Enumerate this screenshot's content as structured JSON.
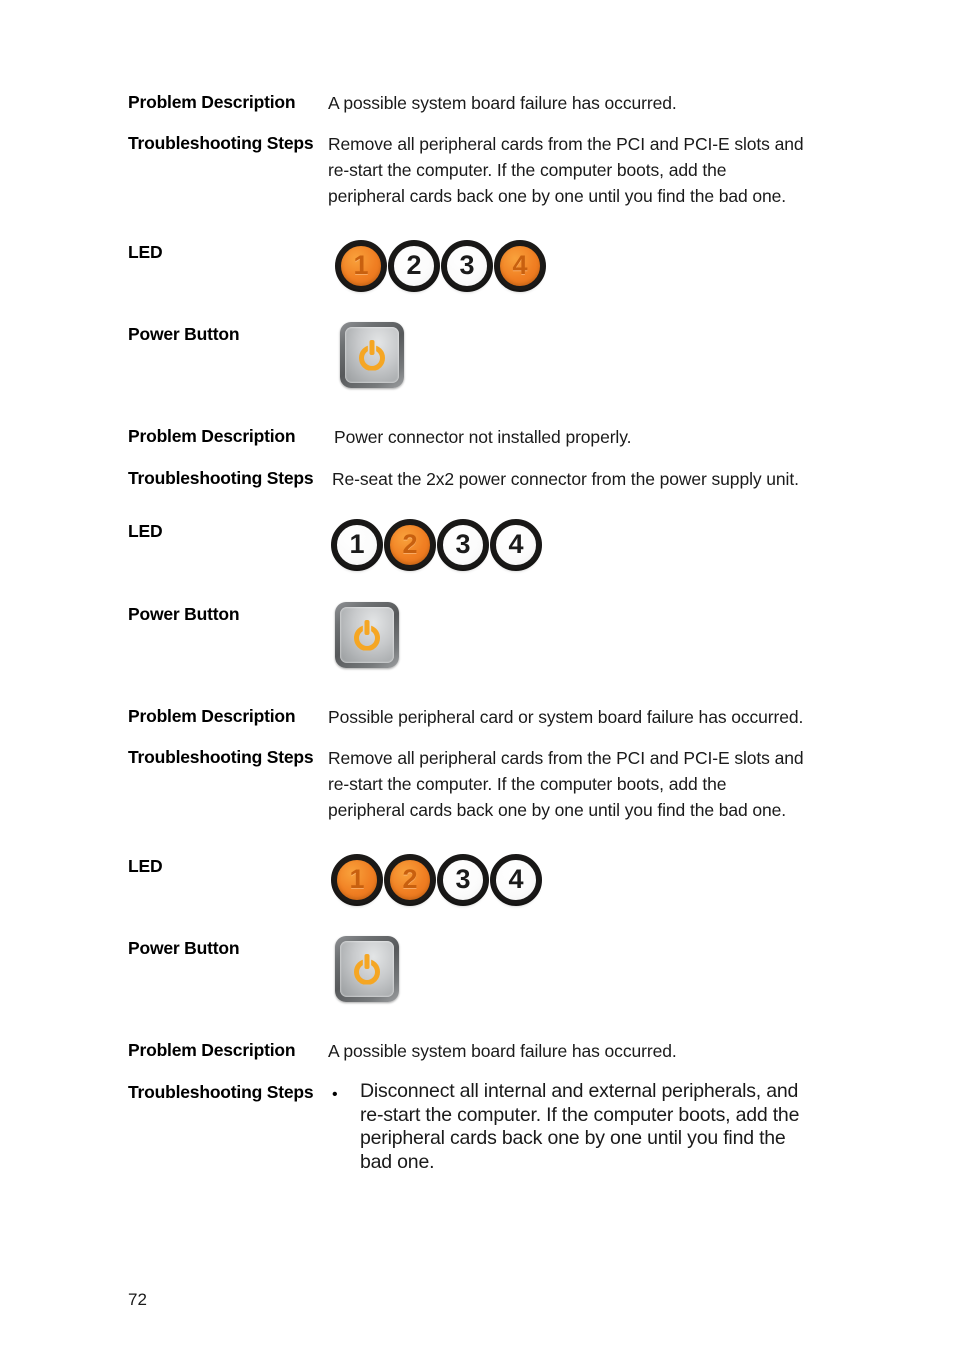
{
  "document": {
    "page_number": "72",
    "colors": {
      "led_on": "#f07e22",
      "led_off": "#ffffff",
      "power_glyph": "#f5a623",
      "text": "#1a1a1a"
    }
  },
  "labels": {
    "problem_description": "Problem Description",
    "troubleshooting_steps": "Troubleshooting Steps",
    "led": "LED",
    "power_button": "Power Button"
  },
  "sections": [
    {
      "problem_description": "A possible system board failure has occurred.",
      "troubleshooting_lines": [
        "Remove all peripheral cards from the PCI and PCI-E slots and",
        "re-start the computer. If the computer boots, add the",
        "peripheral cards back one by one until you find the bad one."
      ],
      "led_states": [
        {
          "number": "1",
          "lit": true
        },
        {
          "number": "2",
          "lit": false
        },
        {
          "number": "3",
          "lit": false
        },
        {
          "number": "4",
          "lit": true
        }
      ],
      "power_button_state": "on"
    },
    {
      "problem_description": "Power connector not installed properly.",
      "troubleshooting_lines": [
        "Re-seat the 2x2 power connector from the power supply unit."
      ],
      "led_states": [
        {
          "number": "1",
          "lit": false
        },
        {
          "number": "2",
          "lit": true
        },
        {
          "number": "3",
          "lit": false
        },
        {
          "number": "4",
          "lit": false
        }
      ],
      "power_button_state": "on"
    },
    {
      "problem_description": "Possible peripheral card or system board failure has occurred.",
      "troubleshooting_lines": [
        "Remove all peripheral cards from the PCI and PCI-E slots and",
        "re-start the computer. If the computer boots, add the",
        "peripheral cards back one by one until you find the bad one."
      ],
      "led_states": [
        {
          "number": "1",
          "lit": true
        },
        {
          "number": "2",
          "lit": true
        },
        {
          "number": "3",
          "lit": false
        },
        {
          "number": "4",
          "lit": false
        }
      ],
      "power_button_state": "on"
    },
    {
      "problem_description": "A possible system board failure has occurred.",
      "bullet_marker": "•",
      "troubleshooting_bullet_lines": [
        "Disconnect all internal and external peripherals, and",
        "re-start the computer. If the computer boots, add the",
        "peripheral cards back one by one until you find the",
        "bad one."
      ]
    }
  ]
}
